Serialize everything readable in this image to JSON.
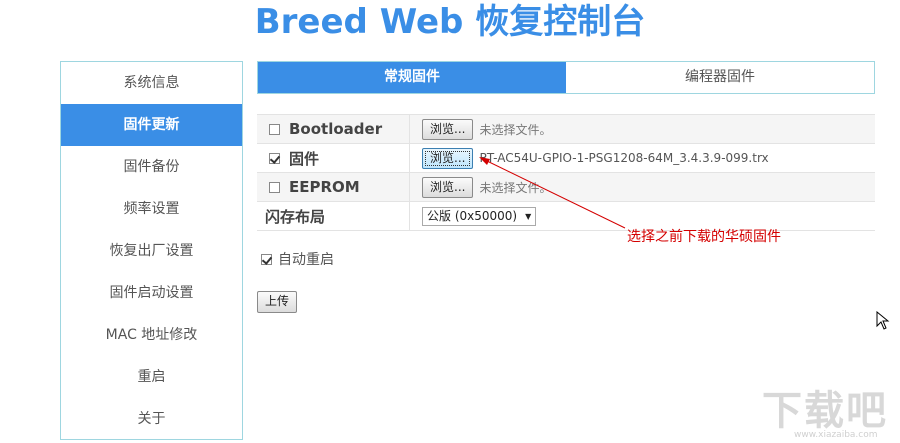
{
  "title": "Breed Web 恢复控制台",
  "sidebar": {
    "items": [
      {
        "label": "系统信息",
        "active": false
      },
      {
        "label": "固件更新",
        "active": true
      },
      {
        "label": "固件备份",
        "active": false
      },
      {
        "label": "频率设置",
        "active": false
      },
      {
        "label": "恢复出厂设置",
        "active": false
      },
      {
        "label": "固件启动设置",
        "active": false
      },
      {
        "label": "MAC 地址修改",
        "active": false
      },
      {
        "label": "重启",
        "active": false
      },
      {
        "label": "关于",
        "active": false
      }
    ]
  },
  "tabs": [
    {
      "label": "常规固件",
      "active": true
    },
    {
      "label": "编程器固件",
      "active": false
    }
  ],
  "form": {
    "rows": [
      {
        "label": "Bootloader",
        "checked": false,
        "button": "浏览...",
        "file": "未选择文件。"
      },
      {
        "label": "固件",
        "checked": true,
        "button": "浏览...",
        "file": "RT-AC54U-GPIO-1-PSG1208-64M_3.4.3.9-099.trx"
      },
      {
        "label": "EEPROM",
        "checked": false,
        "button": "浏览...",
        "file": "未选择文件。"
      }
    ],
    "layout_label": "闪存布局",
    "layout_value": "公版 (0x50000)"
  },
  "auto_reboot": {
    "label": "自动重启",
    "checked": true
  },
  "upload_button": "上传",
  "annotation": "选择之前下载的华硕固件",
  "watermark": {
    "text": "下载吧",
    "sub": "www.xiazaiba.com"
  },
  "colors": {
    "accent": "#3a8ee6",
    "border": "#9ed6e0",
    "annotation": "#d40000"
  }
}
